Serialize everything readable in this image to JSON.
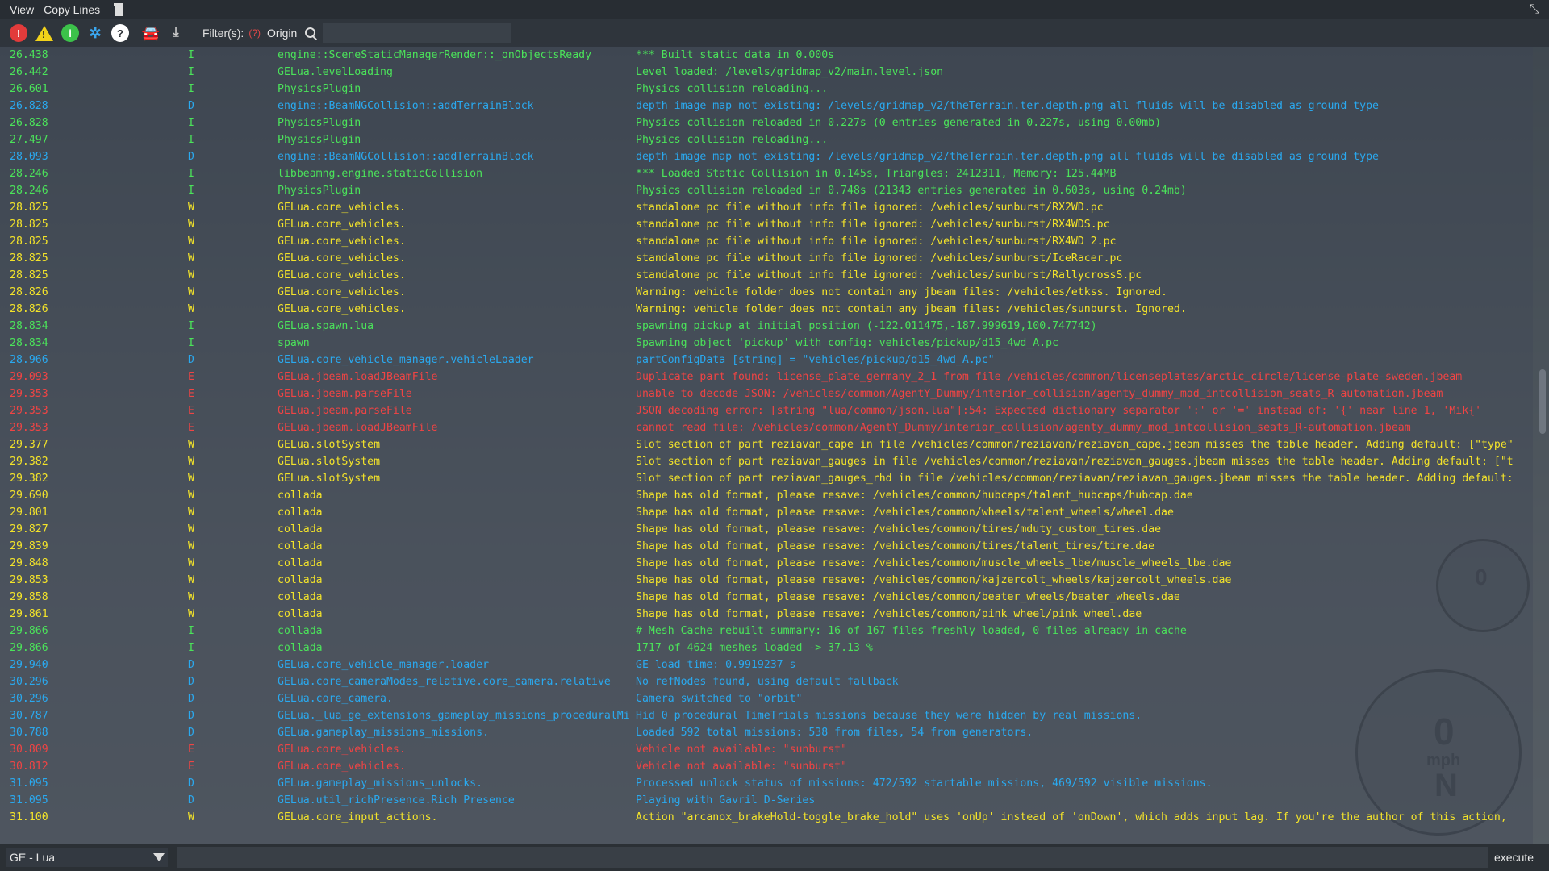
{
  "menubar": {
    "items": [
      "View",
      "Copy Lines"
    ],
    "restore_glyph": "⤡"
  },
  "toolbar": {
    "error_glyph": "!",
    "warning_glyph": "!",
    "info_glyph": "i",
    "debug_glyph": "✲",
    "help_glyph": "?",
    "car_glyph": "🚘",
    "download_glyph": "⤓",
    "filter_label": "Filter(s):",
    "filter_help": "(?)",
    "filter_origin": "Origin",
    "search_placeholder": ""
  },
  "colors": {
    "I": "#4be35a",
    "D": "#2aa9ef",
    "W": "#f3e32a",
    "E": "#f04444"
  },
  "log": [
    [
      "26.438",
      "I",
      "engine::SceneStaticManagerRender::_onObjectsReady",
      "*** Built static data in 0.000s"
    ],
    [
      "26.442",
      "I",
      "GELua.levelLoading",
      "Level loaded: /levels/gridmap_v2/main.level.json"
    ],
    [
      "26.601",
      "I",
      "PhysicsPlugin",
      "Physics collision reloading..."
    ],
    [
      "26.828",
      "D",
      "engine::BeamNGCollision::addTerrainBlock",
      "depth image map not existing: /levels/gridmap_v2/theTerrain.ter.depth.png all fluids will be disabled as ground type"
    ],
    [
      "26.828",
      "I",
      "PhysicsPlugin",
      "Physics collision reloaded in 0.227s (0 entries generated in 0.227s, using  0.00mb)"
    ],
    [
      "27.497",
      "I",
      "PhysicsPlugin",
      "Physics collision reloading..."
    ],
    [
      "28.093",
      "D",
      "engine::BeamNGCollision::addTerrainBlock",
      "depth image map not existing: /levels/gridmap_v2/theTerrain.ter.depth.png all fluids will be disabled as ground type"
    ],
    [
      "28.246",
      "I",
      "libbeamng.engine.staticCollision",
      "*** Loaded Static Collision in 0.145s, Triangles: 2412311, Memory: 125.44MB"
    ],
    [
      "28.246",
      "I",
      "PhysicsPlugin",
      "Physics collision reloaded in 0.748s (21343 entries generated in 0.603s, using  0.24mb)"
    ],
    [
      "28.825",
      "W",
      "GELua.core_vehicles.",
      "standalone pc file without info file ignored: /vehicles/sunburst/RX2WD.pc"
    ],
    [
      "28.825",
      "W",
      "GELua.core_vehicles.",
      "standalone pc file without info file ignored: /vehicles/sunburst/RX4WDS.pc"
    ],
    [
      "28.825",
      "W",
      "GELua.core_vehicles.",
      "standalone pc file without info file ignored: /vehicles/sunburst/RX4WD 2.pc"
    ],
    [
      "28.825",
      "W",
      "GELua.core_vehicles.",
      "standalone pc file without info file ignored: /vehicles/sunburst/IceRacer.pc"
    ],
    [
      "28.825",
      "W",
      "GELua.core_vehicles.",
      "standalone pc file without info file ignored: /vehicles/sunburst/RallycrossS.pc"
    ],
    [
      "28.826",
      "W",
      "GELua.core_vehicles.",
      "Warning: vehicle folder does not contain any jbeam files: /vehicles/etkss. Ignored."
    ],
    [
      "28.826",
      "W",
      "GELua.core_vehicles.",
      "Warning: vehicle folder does not contain any jbeam files: /vehicles/sunburst. Ignored."
    ],
    [
      "28.834",
      "I",
      "GELua.spawn.lua",
      "spawning pickup at initial position (-122.011475,-187.999619,100.747742)"
    ],
    [
      "28.834",
      "I",
      "spawn",
      "Spawning object 'pickup' with config: vehicles/pickup/d15_4wd_A.pc"
    ],
    [
      "28.966",
      "D",
      "GELua.core_vehicle_manager.vehicleLoader",
      "partConfigData [string] = \"vehicles/pickup/d15_4wd_A.pc\""
    ],
    [
      "29.093",
      "E",
      "GELua.jbeam.loadJBeamFile",
      "Duplicate part found: license_plate_germany_2_1 from file /vehicles/common/licenseplates/arctic_circle/license-plate-sweden.jbeam"
    ],
    [
      "29.353",
      "E",
      "GELua.jbeam.parseFile",
      "unable to decode JSON: /vehicles/common/AgentY_Dummy/interior_collision/agenty_dummy_mod_intcollision_seats_R-automation.jbeam"
    ],
    [
      "29.353",
      "E",
      "GELua.jbeam.parseFile",
      "JSON decoding error: [string \"lua/common/json.lua\"]:54: Expected dictionary separator ':' or '=' instead of: '{' near line 1, 'Mik{'"
    ],
    [
      "29.353",
      "E",
      "GELua.jbeam.loadJBeamFile",
      "cannot read file: /vehicles/common/AgentY_Dummy/interior_collision/agenty_dummy_mod_intcollision_seats_R-automation.jbeam"
    ],
    [
      "29.377",
      "W",
      "GELua.slotSystem",
      "Slot section of part reziavan_cape in file /vehicles/common/reziavan/reziavan_cape.jbeam misses the table header. Adding default: [\"type\""
    ],
    [
      "29.382",
      "W",
      "GELua.slotSystem",
      "Slot section of part reziavan_gauges in file /vehicles/common/reziavan/reziavan_gauges.jbeam misses the table header. Adding default: [\"t"
    ],
    [
      "29.382",
      "W",
      "GELua.slotSystem",
      "Slot section of part reziavan_gauges_rhd in file /vehicles/common/reziavan/reziavan_gauges.jbeam misses the table header. Adding default:"
    ],
    [
      "29.690",
      "W",
      "collada",
      "Shape has old format, please resave: /vehicles/common/hubcaps/talent_hubcaps/hubcap.dae"
    ],
    [
      "29.801",
      "W",
      "collada",
      "Shape has old format, please resave: /vehicles/common/wheels/talent_wheels/wheel.dae"
    ],
    [
      "29.827",
      "W",
      "collada",
      "Shape has old format, please resave: /vehicles/common/tires/mduty_custom_tires.dae"
    ],
    [
      "29.839",
      "W",
      "collada",
      "Shape has old format, please resave: /vehicles/common/tires/talent_tires/tire.dae"
    ],
    [
      "29.848",
      "W",
      "collada",
      "Shape has old format, please resave: /vehicles/common/muscle_wheels_lbe/muscle_wheels_lbe.dae"
    ],
    [
      "29.853",
      "W",
      "collada",
      "Shape has old format, please resave: /vehicles/common/kajzercolt_wheels/kajzercolt_wheels.dae"
    ],
    [
      "29.858",
      "W",
      "collada",
      "Shape has old format, please resave: /vehicles/common/beater_wheels/beater_wheels.dae"
    ],
    [
      "29.861",
      "W",
      "collada",
      "Shape has old format, please resave: /vehicles/common/pink_wheel/pink_wheel.dae"
    ],
    [
      "29.866",
      "I",
      "collada",
      " # Mesh Cache rebuilt summary: 16 of 167 files freshly loaded, 0 files already in cache"
    ],
    [
      "29.866",
      "I",
      "collada",
      "1717 of 4624 meshes loaded -> 37.13 %"
    ],
    [
      "29.940",
      "D",
      "GELua.core_vehicle_manager.loader",
      "GE load time: 0.9919237 s"
    ],
    [
      "30.296",
      "D",
      "GELua.core_cameraModes_relative.core_camera.relative",
      "No refNodes found, using default fallback"
    ],
    [
      "30.296",
      "D",
      "GELua.core_camera.",
      "Camera switched to \"orbit\""
    ],
    [
      "30.787",
      "D",
      "GELua._lua_ge_extensions_gameplay_missions_proceduralMi",
      "Hid 0 procedural TimeTrials missions because they were hidden by real missions."
    ],
    [
      "30.788",
      "D",
      "GELua.gameplay_missions_missions.",
      "Loaded 592 total missions: 538 from files, 54 from generators."
    ],
    [
      "30.809",
      "E",
      "GELua.core_vehicles.",
      "Vehicle not available: \"sunburst\""
    ],
    [
      "30.812",
      "E",
      "GELua.core_vehicles.",
      "Vehicle not available: \"sunburst\""
    ],
    [
      "31.095",
      "D",
      "GELua.gameplay_missions_unlocks.",
      "Processed unlock status of missions: 472/592 startable missions, 469/592 visible missions."
    ],
    [
      "31.095",
      "D",
      "GELua.util_richPresence.Rich Presence",
      "Playing with Gavril D-Series"
    ],
    [
      "31.100",
      "W",
      "GELua.core_input_actions.",
      "Action \"arcanox_brakeHold-toggle_brake_hold\" uses 'onUp' instead of 'onDown', which adds input lag. If you're the author of this action,"
    ]
  ],
  "cmdbar": {
    "context": "GE - Lua",
    "input_value": "",
    "execute_label": "execute"
  },
  "hud": {
    "speed": "0",
    "unit": "mph",
    "gear": "N",
    "gauge_small": "0"
  }
}
